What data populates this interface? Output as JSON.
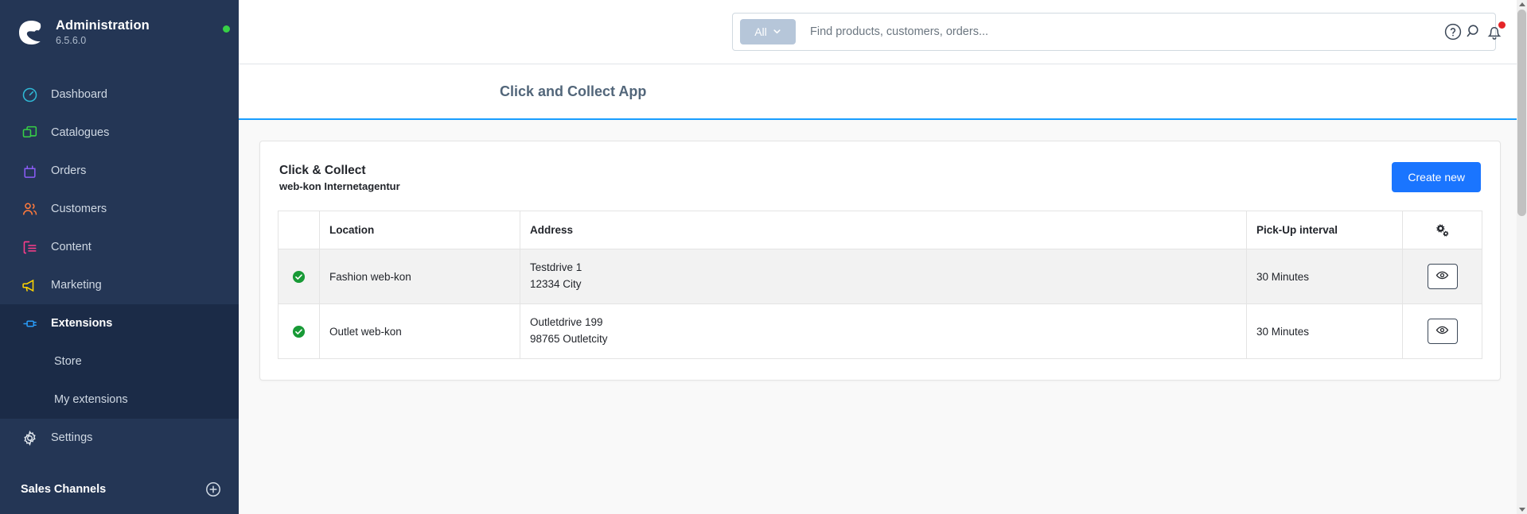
{
  "sidebar": {
    "brand": {
      "title": "Administration",
      "version": "6.5.6.0",
      "logo_icon": "shopware-logo-icon",
      "status_dot_color": "#37d046"
    },
    "items": [
      {
        "label": "Dashboard",
        "icon": "dashboard-gauge-icon",
        "color": "#2fb9d6"
      },
      {
        "label": "Catalogues",
        "icon": "catalogues-stack-icon",
        "color": "#37d046"
      },
      {
        "label": "Orders",
        "icon": "orders-bag-icon",
        "color": "#8b5cf6"
      },
      {
        "label": "Customers",
        "icon": "customers-people-icon",
        "color": "#ff7a3c"
      },
      {
        "label": "Content",
        "icon": "content-layout-icon",
        "color": "#ff3d8b"
      },
      {
        "label": "Marketing",
        "icon": "marketing-megaphone-icon",
        "color": "#ffd500"
      },
      {
        "label": "Extensions",
        "icon": "extensions-plug-icon",
        "color": "#2a9cf8",
        "active": true
      }
    ],
    "sub_items": [
      {
        "label": "Store"
      },
      {
        "label": "My extensions"
      }
    ],
    "settings": {
      "label": "Settings",
      "icon": "gear-icon"
    },
    "sales_channels": {
      "label": "Sales Channels",
      "add_icon": "plus-circle-icon"
    }
  },
  "topbar": {
    "search": {
      "scope_label": "All",
      "scope_caret_icon": "chevron-down-icon",
      "placeholder": "Find products, customers, orders...",
      "value": "",
      "search_icon": "search-icon"
    },
    "help_icon": "help-circle-icon",
    "notifications_icon": "bell-icon",
    "notifications_badge_color": "#e52427"
  },
  "page": {
    "title": "Click and Collect App",
    "accent_color": "#189eff"
  },
  "card": {
    "title": "Click & Collect",
    "subtitle": "web-kon Internetagentur",
    "create_button": {
      "label": "Create new",
      "color": "#1a75ff"
    }
  },
  "table": {
    "columns": [
      {
        "key": "status",
        "label": ""
      },
      {
        "key": "location",
        "label": "Location"
      },
      {
        "key": "address",
        "label": "Address"
      },
      {
        "key": "interval",
        "label": "Pick-Up interval"
      },
      {
        "key": "actions",
        "label": "",
        "icon": "settings-columns-gear-icon"
      }
    ],
    "rows": [
      {
        "status_icon": "check-circle-icon",
        "status_color": "#189a36",
        "location": "Fashion web-kon",
        "address_line1": "Testdrive 1",
        "address_line2": "12334 City",
        "interval": "30 Minutes",
        "action_icon": "eye-icon",
        "highlighted": true
      },
      {
        "status_icon": "check-circle-icon",
        "status_color": "#189a36",
        "location": "Outlet web-kon",
        "address_line1": "Outletdrive 199",
        "address_line2": "98765 Outletcity",
        "interval": "30 Minutes",
        "action_icon": "eye-icon",
        "highlighted": false
      }
    ]
  }
}
